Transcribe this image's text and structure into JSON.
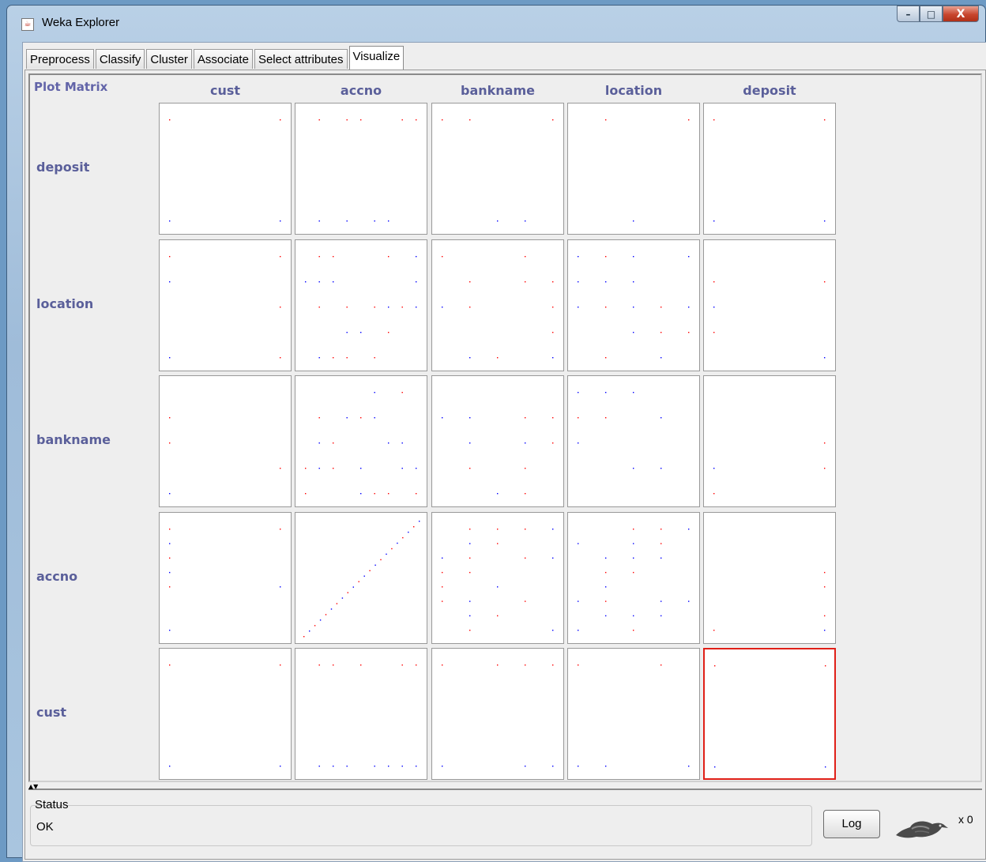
{
  "window": {
    "title": "Weka Explorer",
    "controls": {
      "minimize": "–",
      "maximize": "□",
      "close": "X"
    }
  },
  "tabs": [
    {
      "label": "Preprocess",
      "active": false
    },
    {
      "label": "Classify",
      "active": false
    },
    {
      "label": "Cluster",
      "active": false
    },
    {
      "label": "Associate",
      "active": false
    },
    {
      "label": "Select attributes",
      "active": false
    },
    {
      "label": "Visualize",
      "active": true
    }
  ],
  "plot_matrix": {
    "label": "Plot Matrix",
    "columns": [
      "cust",
      "accno",
      "bankname",
      "location",
      "deposit"
    ],
    "rows": [
      "deposit",
      "location",
      "bankname",
      "accno",
      "cust"
    ],
    "selected_cell": {
      "row": "cust",
      "column": "deposit"
    },
    "colors": {
      "class_a": "#0000ff",
      "class_b": "#ff0000",
      "selected_border": "#e02018",
      "label": "#5a5f9a"
    }
  },
  "status": {
    "title": "Status",
    "text": "OK"
  },
  "log_button": "Log",
  "task_count": "x 0",
  "icons": {
    "app": "java-cup-icon",
    "weka": "weka-bird-icon"
  }
}
